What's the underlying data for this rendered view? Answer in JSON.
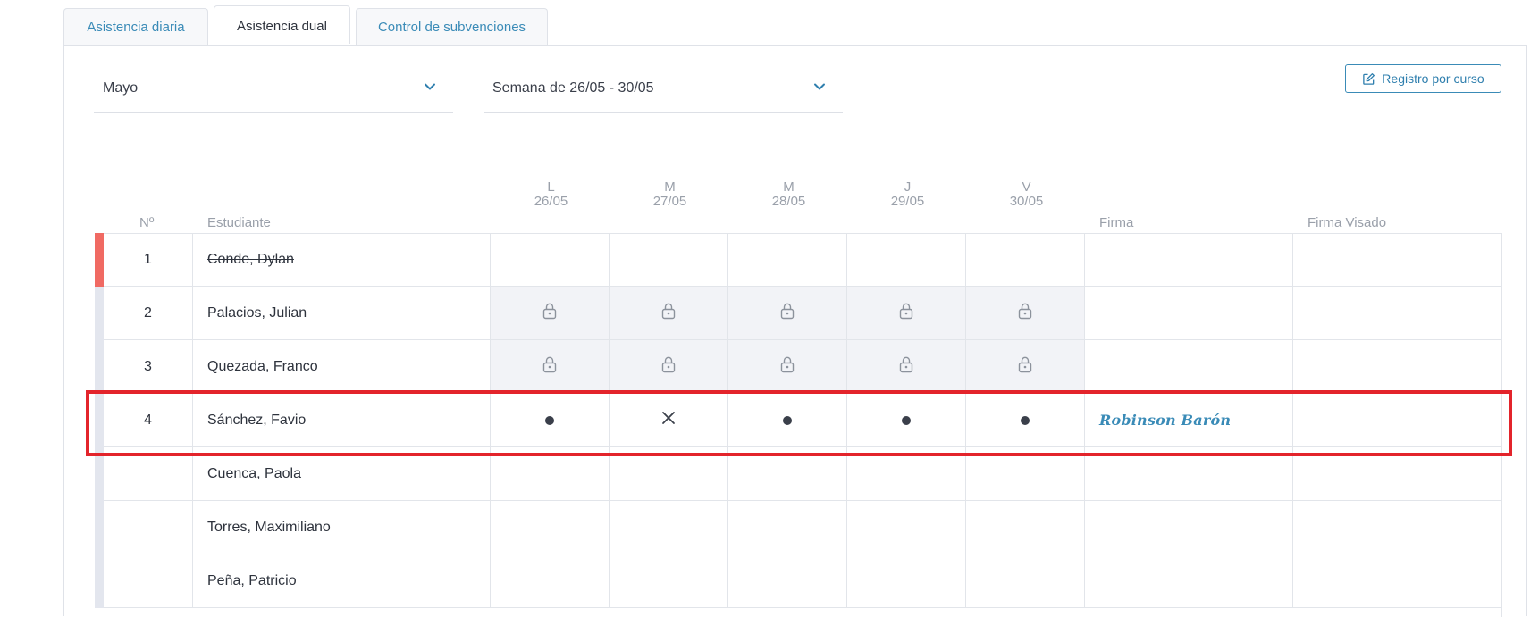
{
  "tabs": [
    {
      "label": "Asistencia diaria",
      "active": false
    },
    {
      "label": "Asistencia dual",
      "active": true
    },
    {
      "label": "Control de subvenciones",
      "active": false
    }
  ],
  "filters": {
    "month": "Mayo",
    "week": "Semana de 26/05 - 30/05"
  },
  "actions": {
    "register_label": "Registro por curso"
  },
  "table": {
    "col_num": "Nº",
    "col_student": "Estudiante",
    "col_firma": "Firma",
    "col_visado": "Firma Visado",
    "days": [
      {
        "day": "L",
        "date": "26/05"
      },
      {
        "day": "M",
        "date": "27/05"
      },
      {
        "day": "M",
        "date": "28/05"
      },
      {
        "day": "J",
        "date": "29/05"
      },
      {
        "day": "V",
        "date": "30/05"
      }
    ],
    "rows": [
      {
        "num": "1",
        "name": "Conde, Dylan",
        "withdrawn": true,
        "marks": [
          "",
          "",
          "",
          "",
          ""
        ],
        "firma": ""
      },
      {
        "num": "2",
        "name": "Palacios, Julian",
        "withdrawn": false,
        "marks": [
          "lock",
          "lock",
          "lock",
          "lock",
          "lock"
        ],
        "firma": ""
      },
      {
        "num": "3",
        "name": "Quezada, Franco",
        "withdrawn": false,
        "marks": [
          "lock",
          "lock",
          "lock",
          "lock",
          "lock"
        ],
        "firma": ""
      },
      {
        "num": "4",
        "name": "Sánchez, Favio",
        "withdrawn": false,
        "marks": [
          "present",
          "absent",
          "present",
          "present",
          "present"
        ],
        "firma": "Robinson Barón"
      },
      {
        "num": "",
        "name": "Cuenca, Paola",
        "withdrawn": false,
        "marks": [
          "",
          "",
          "",
          "",
          ""
        ],
        "firma": ""
      },
      {
        "num": "",
        "name": "Torres, Maximiliano",
        "withdrawn": false,
        "marks": [
          "",
          "",
          "",
          "",
          ""
        ],
        "firma": ""
      },
      {
        "num": "",
        "name": "Peña, Patricio",
        "withdrawn": false,
        "marks": [
          "",
          "",
          "",
          "",
          ""
        ],
        "firma": ""
      }
    ]
  },
  "colors": {
    "accent": "#3a8bb7",
    "withdrawn_bar": "#f06a63",
    "highlight_box": "#e3242b"
  }
}
